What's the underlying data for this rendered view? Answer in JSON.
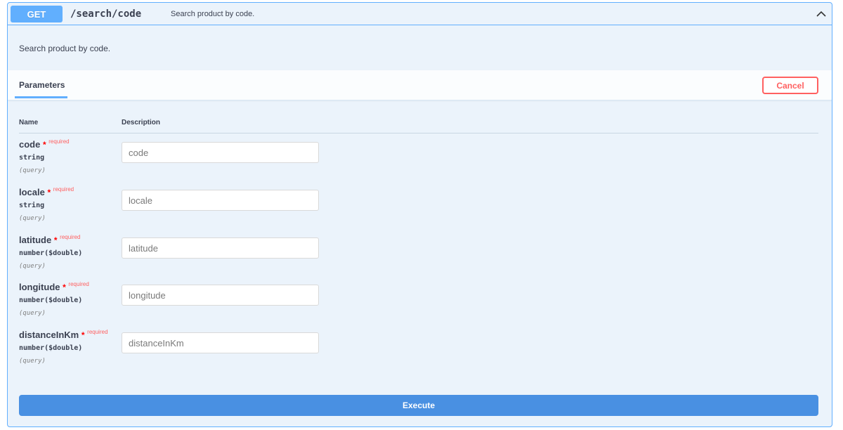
{
  "summary": {
    "method": "GET",
    "path": "/search/code",
    "description": "Search product by code."
  },
  "description": "Search product by code.",
  "parameters_tab": {
    "label": "Parameters"
  },
  "cancel_label": "Cancel",
  "columns": {
    "name": "Name",
    "description": "Description"
  },
  "required_star": "*",
  "required_label": "required",
  "parameters": [
    {
      "name": "code",
      "type": "string",
      "in": "(query)",
      "placeholder": "code"
    },
    {
      "name": "locale",
      "type": "string",
      "in": "(query)",
      "placeholder": "locale"
    },
    {
      "name": "latitude",
      "type": "number($double)",
      "in": "(query)",
      "placeholder": "latitude"
    },
    {
      "name": "longitude",
      "type": "number($double)",
      "in": "(query)",
      "placeholder": "longitude"
    },
    {
      "name": "distanceInKm",
      "type": "number($double)",
      "in": "(query)",
      "placeholder": "distanceInKm"
    }
  ],
  "execute_label": "Execute",
  "icons": {
    "collapse": "chevron-up-icon"
  },
  "colors": {
    "accent": "#61affe",
    "execute": "#4990e2",
    "cancel": "#ff6060",
    "background": "#ebf3fb"
  }
}
